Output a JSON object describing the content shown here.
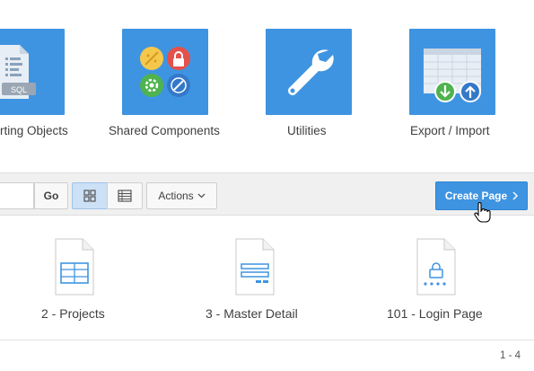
{
  "tiles": [
    {
      "label": "rting Objects",
      "icon": "supporting-objects-sql-icon"
    },
    {
      "label": "Shared Components",
      "icon": "shared-components-icon"
    },
    {
      "label": "Utilities",
      "icon": "wrench-icon"
    },
    {
      "label": "Export / Import",
      "icon": "export-import-icon"
    }
  ],
  "toolbar": {
    "search_value": "",
    "go_label": "Go",
    "grid_view_icon": "grid-view-icon",
    "list_view_icon": "list-view-icon",
    "actions_label": "Actions",
    "create_page_label": "Create Page"
  },
  "pages": [
    {
      "label": "2 - Projects",
      "icon": "table-page-icon"
    },
    {
      "label": "3 - Master Detail",
      "icon": "form-page-icon"
    },
    {
      "label": "101 - Login Page",
      "icon": "login-page-icon"
    }
  ],
  "pagination": "1 - 4",
  "colors": {
    "accent": "#3f94e1",
    "selected_toggle": "#cce0f6"
  }
}
